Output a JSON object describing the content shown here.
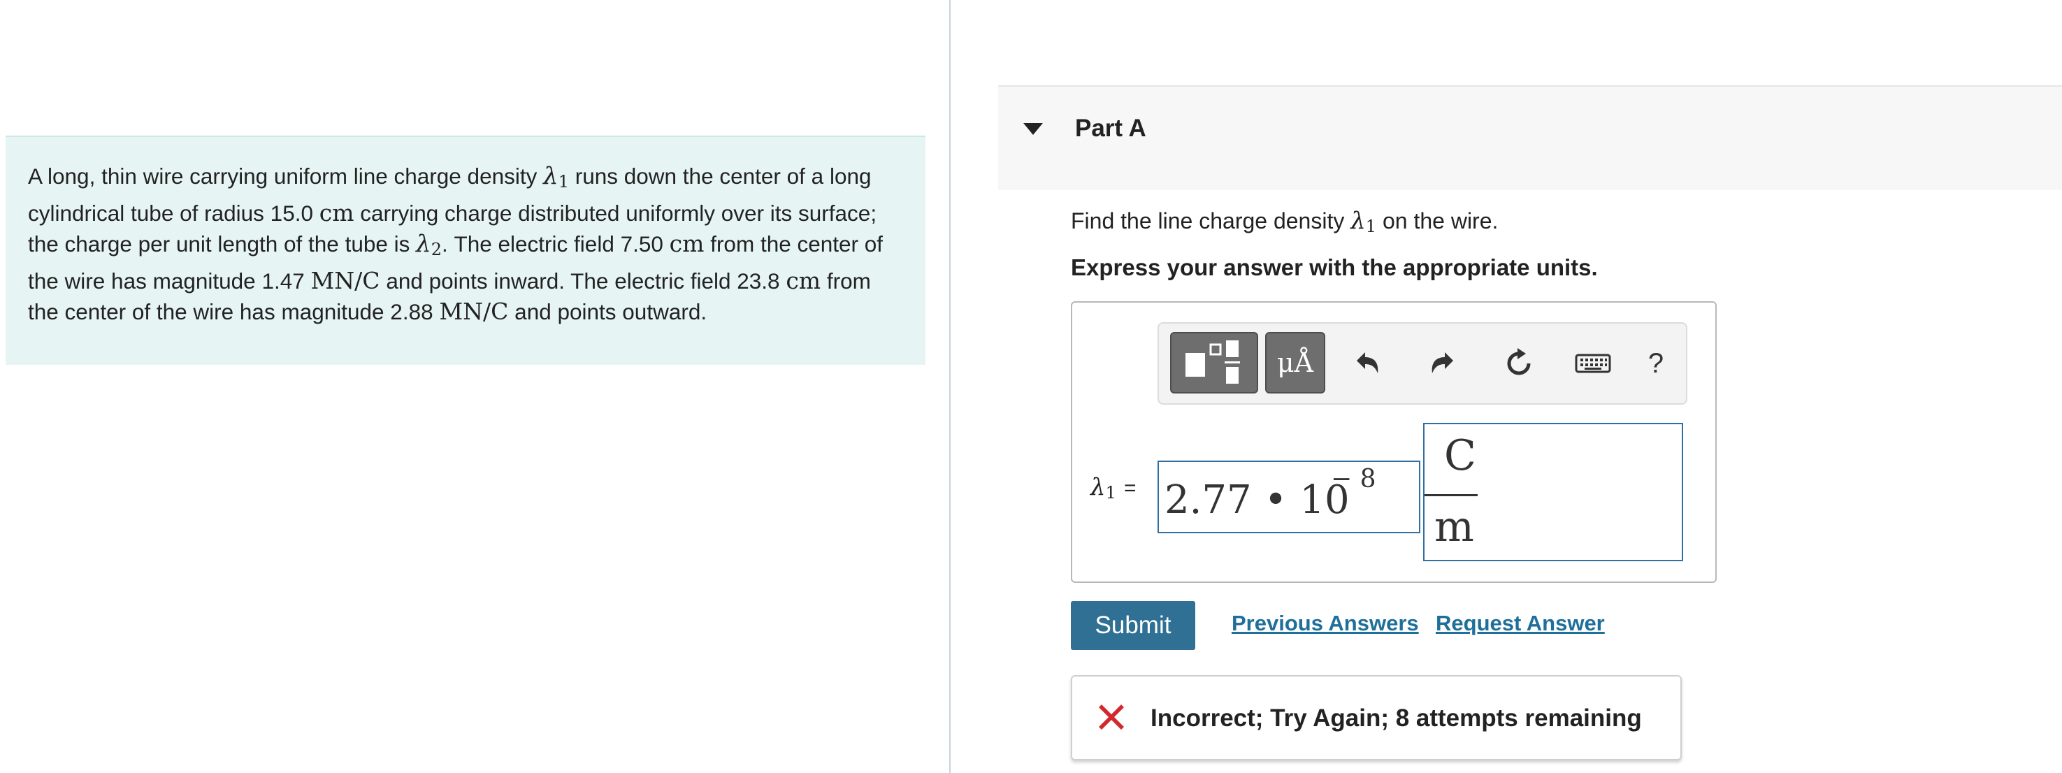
{
  "problem": {
    "seg1": "A long, thin wire carrying uniform line charge density ",
    "lambda1_symbol": "λ",
    "lambda1_sub": "1",
    "seg2": " runs down the center of a long cylindrical tube of radius 15.0 ",
    "unit_cm_1": "cm",
    "seg3": " carrying charge distributed uniformly over its surface; the charge per unit length of the tube is ",
    "lambda2_symbol": "λ",
    "lambda2_sub": "2",
    "seg4": ". The electric field 7.50 ",
    "unit_cm_2": "cm",
    "seg5": " from the center of the wire has magnitude 1.47 ",
    "unit_field_1": "MN/C",
    "seg6": " and points inward. The electric field 23.8 ",
    "unit_cm_3": "cm",
    "seg7": " from the center of the wire has magnitude 2.88 ",
    "unit_field_2": "MN/C",
    "seg8": " and points outward."
  },
  "part": {
    "title": "Part A",
    "question_pre": "Find the line charge density ",
    "question_symbol": "λ",
    "question_sub": "1",
    "question_post": " on the wire.",
    "instructions": "Express your answer with the appropriate units."
  },
  "toolbar": {
    "units_label": "μÅ",
    "help_label": "?",
    "icons": [
      "templates-icon",
      "units-icon",
      "undo-icon",
      "redo-icon",
      "reset-icon",
      "keyboard-icon",
      "help-icon"
    ]
  },
  "answer": {
    "symbol": "λ",
    "sub": "1",
    "equals": "=",
    "value_main": "2.77 • 10",
    "value_exponent": "− 8",
    "unit_numerator": "C",
    "unit_denominator": "m"
  },
  "actions": {
    "submit_label": "Submit",
    "previous_answers_label": "Previous Answers",
    "request_answer_label": "Request Answer"
  },
  "feedback": {
    "text": "Incorrect; Try Again; 8 attempts remaining",
    "icon": "error-x-icon",
    "icon_color": "#d3282d"
  },
  "colors": {
    "problem_bg": "#e6f5f3",
    "submit_bg": "#2f7094",
    "link": "#1e6f99",
    "input_border": "#2f6fa3"
  }
}
